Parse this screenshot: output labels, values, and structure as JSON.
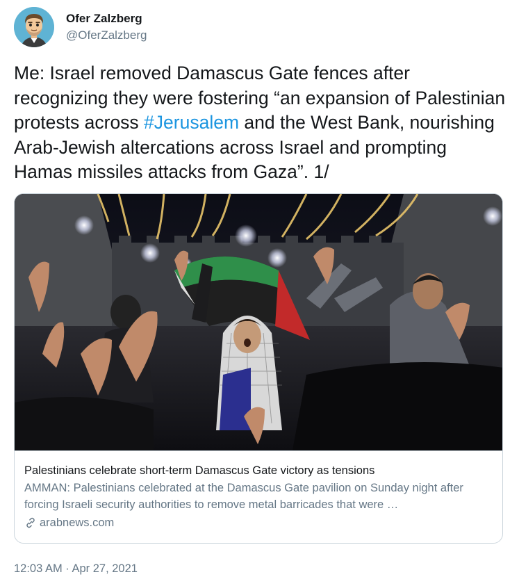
{
  "author": {
    "display_name": "Ofer Zalzberg",
    "handle": "@OferZalzberg",
    "avatar_icon": "cartoon-avatar-icon"
  },
  "tweet": {
    "text_before": "Me: Israel removed Damascus Gate fences after recognizing they were fostering “an expansion of Palestinian protests across ",
    "hashtag": "#Jerusalem",
    "text_after": " and the West Bank, nourishing Arab-Jewish altercations across Israel and prompting Hamas missiles attacks from Gaza”. 1/"
  },
  "link_card": {
    "title": "Palestinians celebrate short-term Damascus Gate victory as tensions",
    "description": "AMMAN: Palestinians celebrated at the Damascus Gate pavilion on Sunday night after forcing Israeli security authorities to remove metal barricades that were …",
    "domain": "arabnews.com",
    "link_icon": "link-icon"
  },
  "timestamp": "12:03 AM · Apr 27, 2021",
  "colors": {
    "hashtag": "#1b95e0",
    "secondary_text": "#657786",
    "primary_text": "#14171a",
    "border": "#ccd6dd"
  }
}
